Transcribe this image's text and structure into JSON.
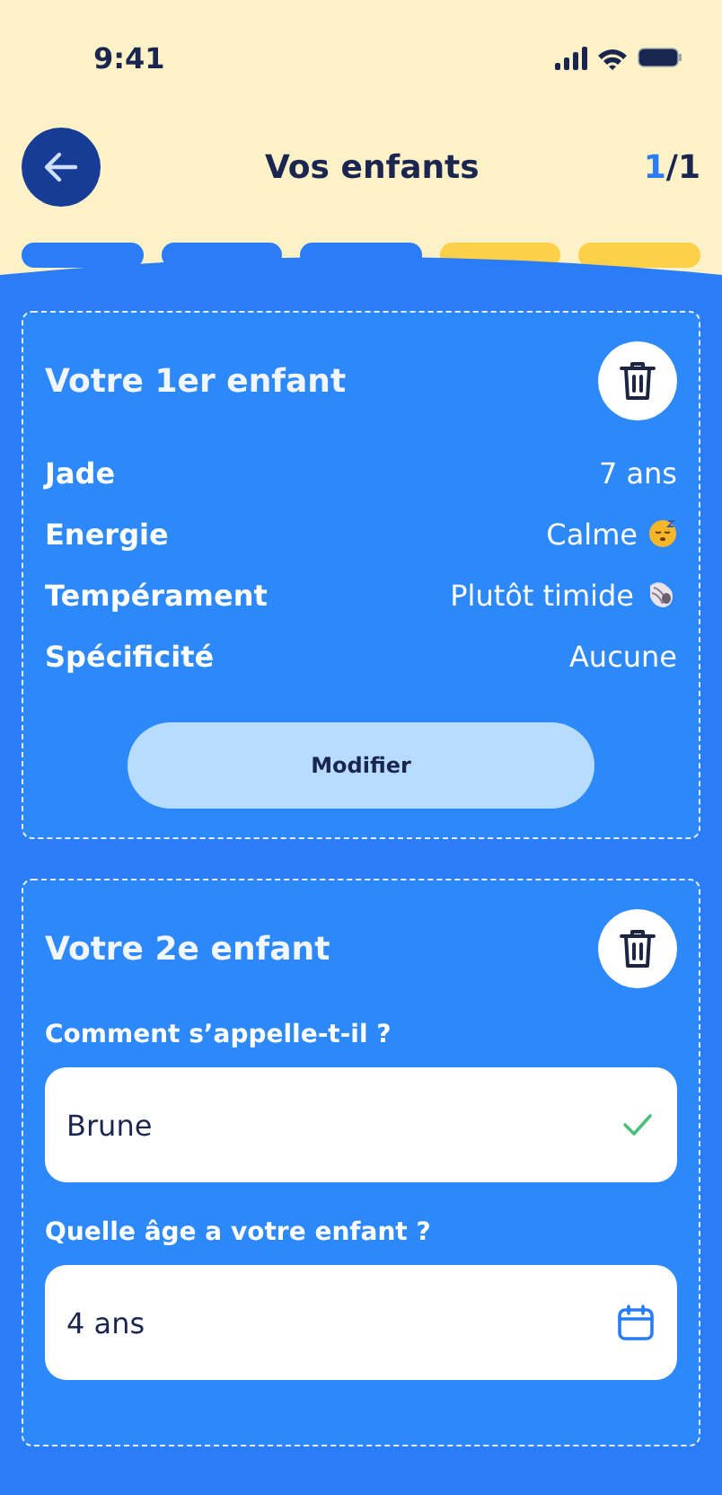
{
  "status_bar": {
    "time": "9:41"
  },
  "header": {
    "title": "Vos enfants",
    "counter_current": "1",
    "counter_rest": "/1"
  },
  "progress": [
    {
      "done": true
    },
    {
      "done": true
    },
    {
      "done": true
    },
    {
      "done": false
    },
    {
      "done": false
    }
  ],
  "cards": [
    {
      "kind": "summary",
      "title": "Votre 1er enfant",
      "rows": [
        {
          "label": "Jade",
          "value": "7 ans"
        },
        {
          "label": "Energie",
          "value": "Calme",
          "kind": "sleepy"
        },
        {
          "label": "Tempérament",
          "value": "Plutôt timide",
          "kind": "shell"
        },
        {
          "label": "Spécificité",
          "value": "Aucune"
        }
      ],
      "button": "Modifier"
    },
    {
      "kind": "form",
      "title": "Votre 2e enfant",
      "fields": [
        {
          "label": "Comment s’appelle-t-il ?",
          "value": "Brune",
          "valid": true
        },
        {
          "label": "Quelle âge a votre enfant ?",
          "value": "4 ans",
          "kind": "date"
        }
      ]
    }
  ]
}
